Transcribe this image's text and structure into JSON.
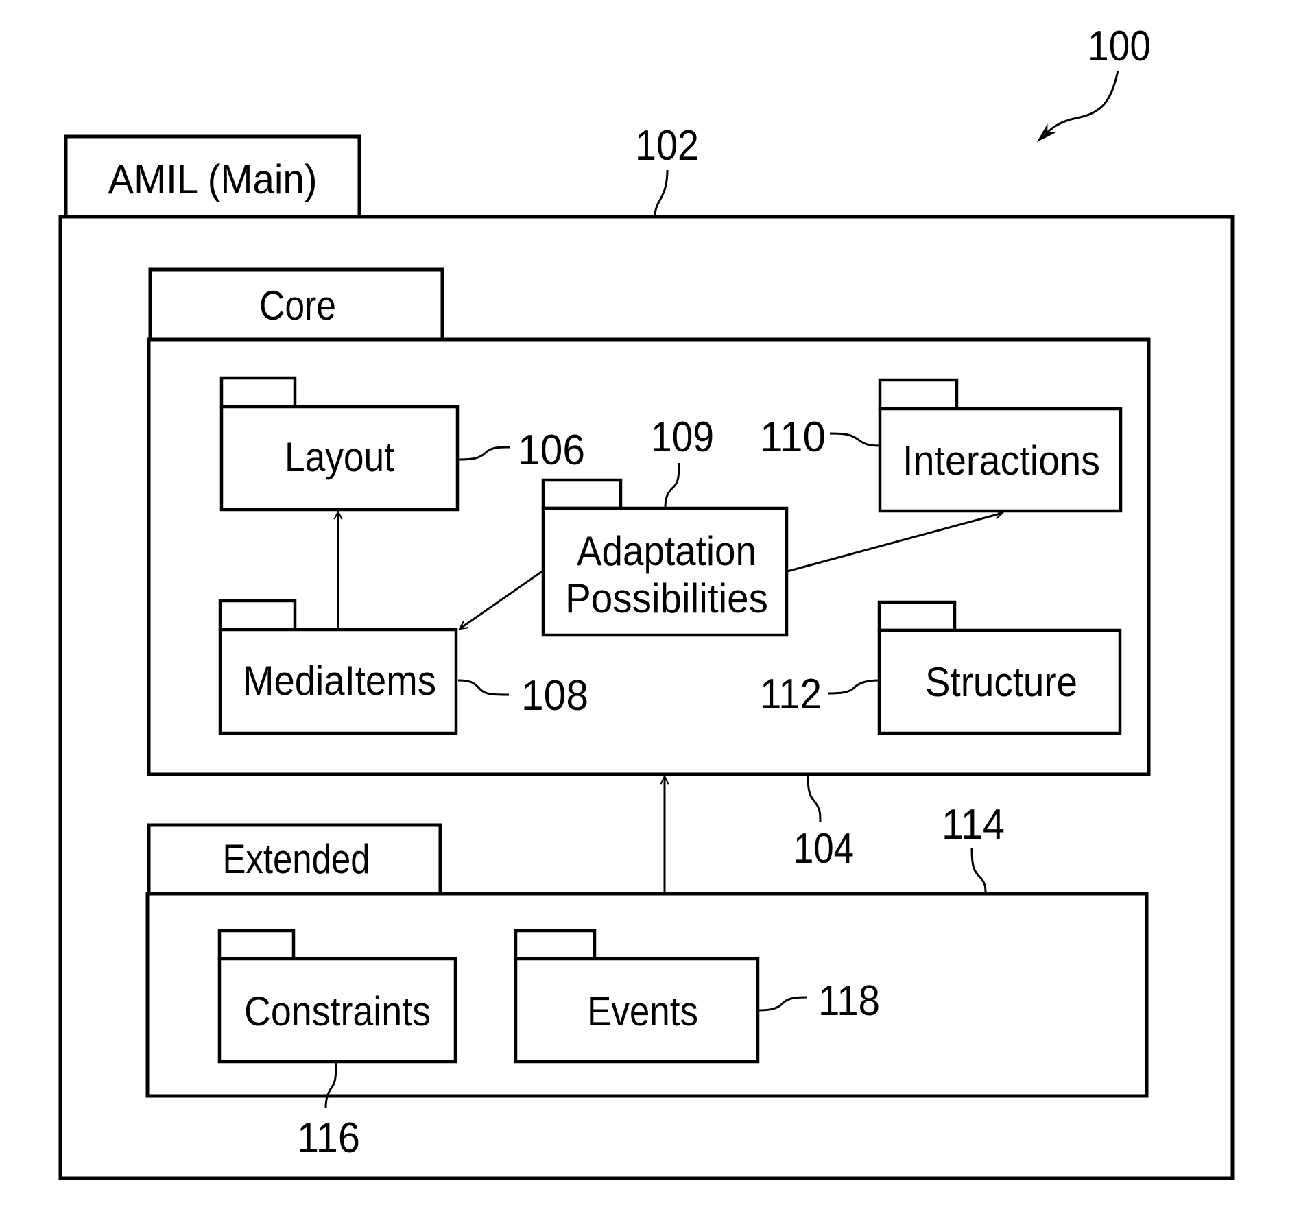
{
  "figure": {
    "ref_number": "100",
    "main_package": {
      "title": "AMIL (Main)",
      "ref": "102"
    },
    "core_package": {
      "title": "Core",
      "ref": "104",
      "subpackages": [
        {
          "id": "layout",
          "title": "Layout",
          "ref": "106"
        },
        {
          "id": "mediaitems",
          "title": "MediaItems",
          "ref": "108"
        },
        {
          "id": "adaptation",
          "title_lines": [
            "Adaptation",
            "Possibilities"
          ],
          "ref": "109"
        },
        {
          "id": "interactions",
          "title": "Interactions",
          "ref": "110"
        },
        {
          "id": "structure",
          "title": "Structure",
          "ref": "112"
        }
      ]
    },
    "extended_package": {
      "title": "Extended",
      "ref": "114",
      "subpackages": [
        {
          "id": "constraints",
          "title": "Constraints",
          "ref": "116"
        },
        {
          "id": "events",
          "title": "Events",
          "ref": "118"
        }
      ]
    },
    "dependencies": [
      {
        "from": "MediaItems",
        "to": "Layout"
      },
      {
        "from": "Adaptation Possibilities",
        "to": "MediaItems"
      },
      {
        "from": "Adaptation Possibilities",
        "to": "Interactions"
      },
      {
        "from": "Extended",
        "to": "Core"
      }
    ]
  }
}
